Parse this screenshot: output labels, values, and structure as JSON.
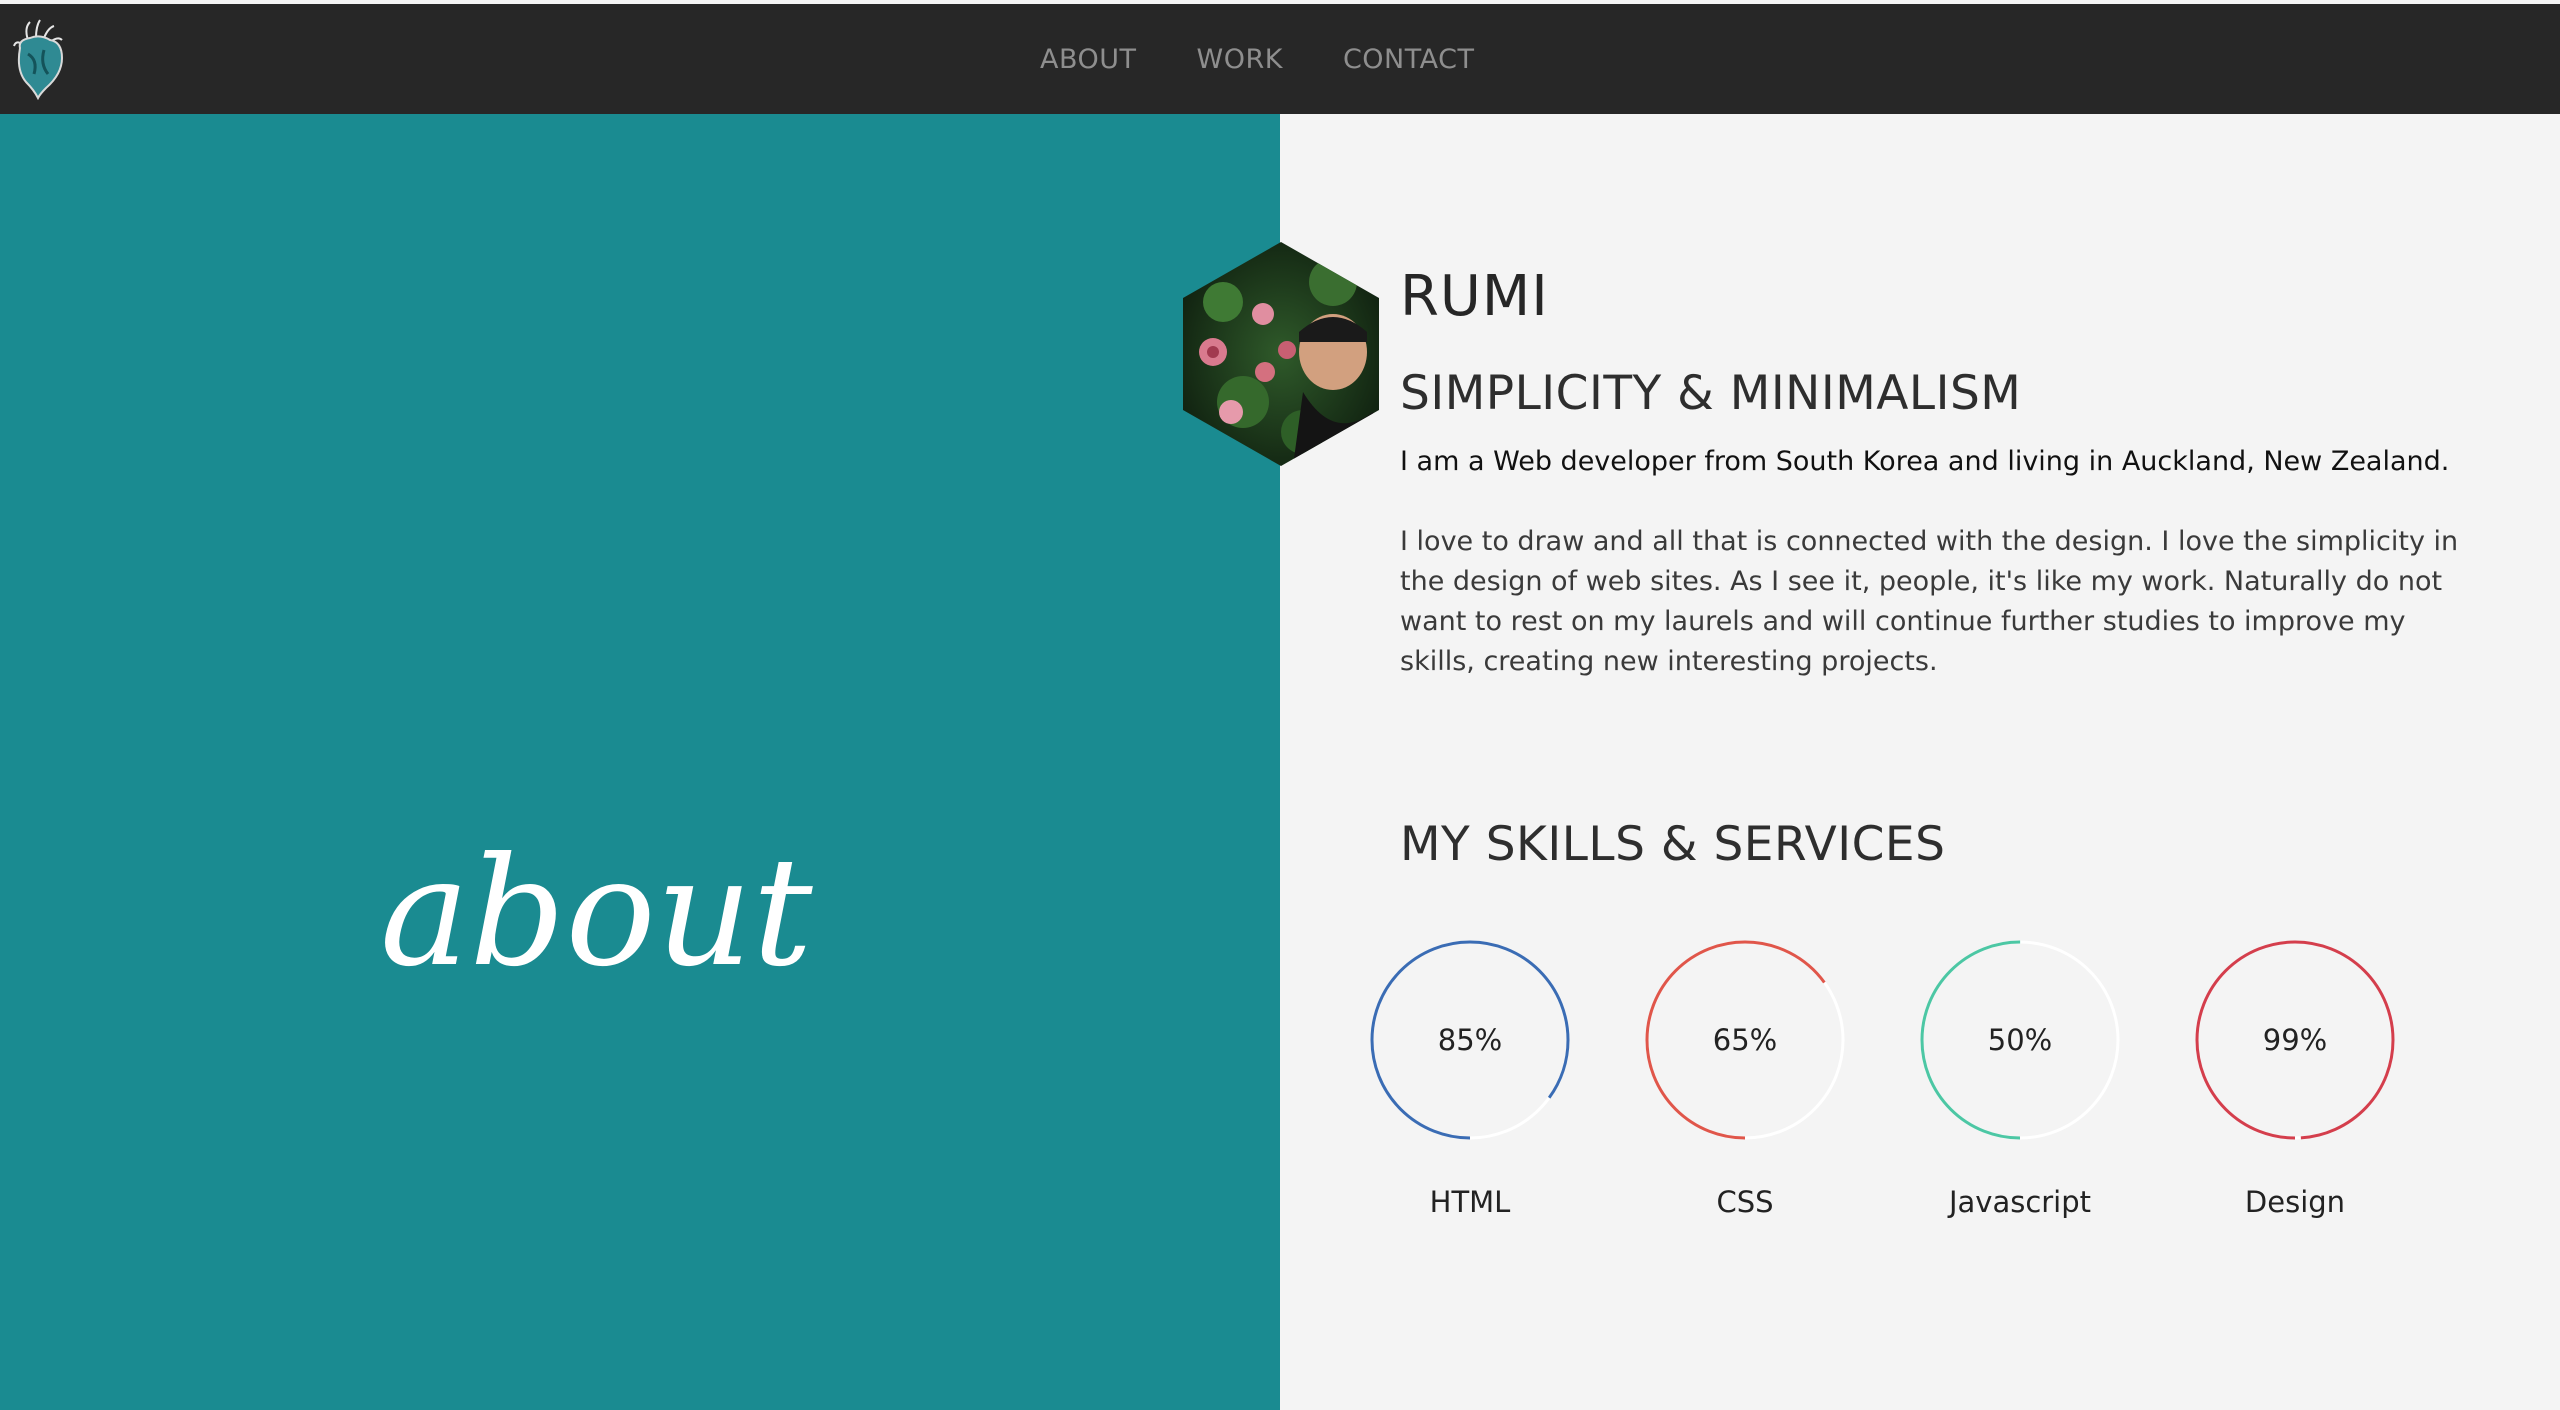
{
  "nav": {
    "items": [
      {
        "label": "ABOUT"
      },
      {
        "label": "WORK"
      },
      {
        "label": "CONTACT"
      }
    ]
  },
  "hero": {
    "script_text": "about",
    "background": "#1a8b91"
  },
  "profile": {
    "name": "RUMI",
    "tagline": "SIMPLICITY & MINIMALISM",
    "intro": "I am a Web developer from South Korea and living in Auckland, New Zealand.",
    "bio": "I love to draw and all that is connected with the design. I love the simplicity in the design of web sites. As I see it, people, it's like my work. Naturally do not want to rest on my laurels and will continue further studies to improve my skills, creating new interesting projects."
  },
  "skills": {
    "title": "MY SKILLS & SERVICES",
    "items": [
      {
        "label": "HTML",
        "percent_text": "85%",
        "value": 85,
        "color": "#3a6cb4"
      },
      {
        "label": "CSS",
        "percent_text": "65%",
        "value": 65,
        "color": "#e0564a"
      },
      {
        "label": "Javascript",
        "percent_text": "50%",
        "value": 50,
        "color": "#4cc7a4"
      },
      {
        "label": "Design",
        "percent_text": "99%",
        "value": 99,
        "color": "#d43e4c"
      }
    ]
  }
}
